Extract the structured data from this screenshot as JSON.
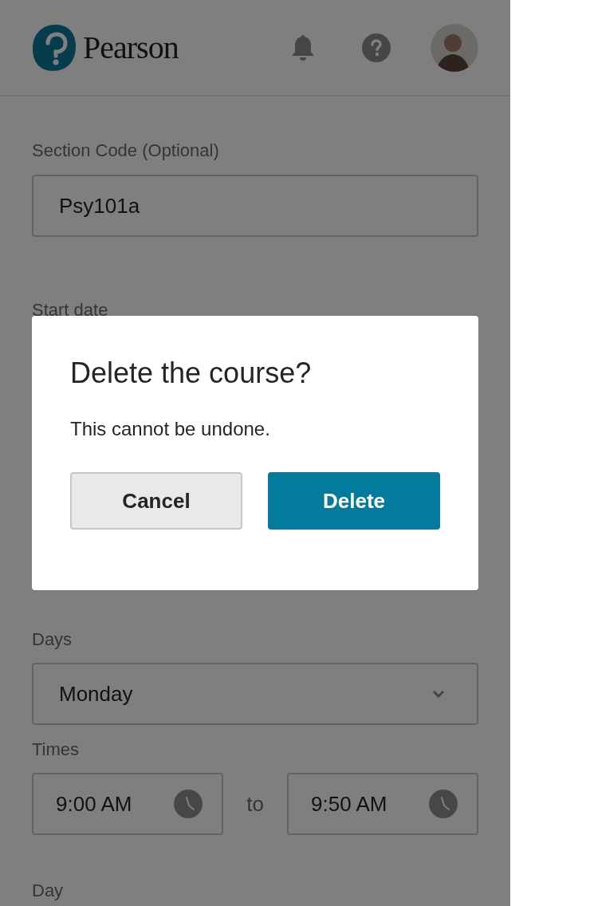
{
  "header": {
    "logo_text": "Pearson"
  },
  "form": {
    "fields": [
      {
        "kind": "text",
        "label": "Section Code (Optional)",
        "value": "Psy101a"
      },
      {
        "kind": "label_only",
        "label": "Start date"
      },
      {
        "kind": "select",
        "label": "Days",
        "value": "Monday"
      },
      {
        "kind": "time_range",
        "label": "Times",
        "from": "9:00 AM",
        "separator": "to",
        "to": "9:50 AM"
      },
      {
        "kind": "label_only",
        "label": "Day"
      }
    ]
  },
  "dialog": {
    "title": "Delete the course?",
    "message": "This cannot be undone.",
    "buttons": [
      {
        "kind": "secondary",
        "label": "Cancel"
      },
      {
        "kind": "primary",
        "label": "Delete"
      }
    ]
  }
}
